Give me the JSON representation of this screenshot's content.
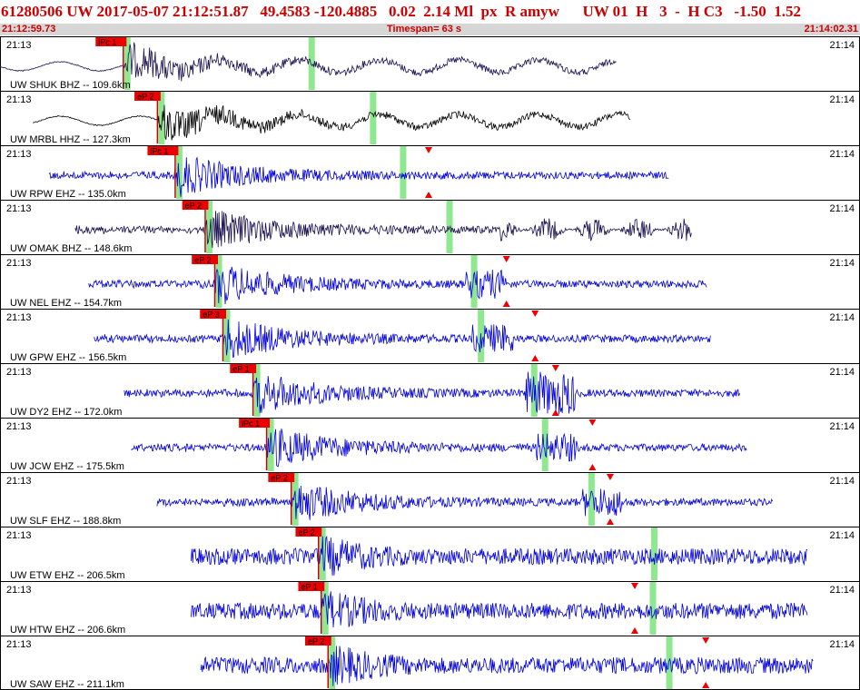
{
  "header": {
    "title": "61280506 UW 2017-05-07 21:12:51.87   49.4583 -120.4885   0.02  2.14 Ml  px  R amyw      UW 01  H   3  -  H C3   -1.50  1.52",
    "start_time": "21:12:59.73",
    "timespan": "Timespan=  63 s",
    "end_time": "21:14:02.31"
  },
  "colors": {
    "title": "#cc0000",
    "subbar_bg": "#d6d6d6",
    "pick_flag": "#ee0000",
    "pick_line": "#cc0000",
    "green_band": "#8fe88f",
    "trace_blue": "#0000dd",
    "trace_dark": "#1a1050",
    "trace_black": "#000000",
    "marker": "#ee0000"
  },
  "chart_data": {
    "type": "seismogram",
    "time_axis": {
      "start": "21:12:59.73",
      "end": "21:14:02.31",
      "span_s": 63
    },
    "panel_time_left": "21:13",
    "panel_time_right": "21:14",
    "traces": [
      {
        "label": "UW SHUK BHZ -- 109.6km",
        "pick": "iPc 1",
        "pick_s": 9.0,
        "green_s": [
          9.0,
          22.5
        ],
        "markers_s": [],
        "color": "dark",
        "start_s": 0.0,
        "end_s": 45.2,
        "pattern": "shuk"
      },
      {
        "label": "UW MRBL HHZ -- 127.3km",
        "pick": "eP 2",
        "pick_s": 11.5,
        "green_s": [
          11.5,
          27.0
        ],
        "markers_s": [],
        "color": "black",
        "start_s": 2.4,
        "end_s": 46.2,
        "pattern": "mrbl"
      },
      {
        "label": "UW RPW EHZ -- 135.0km",
        "pick": "iPc 1",
        "pick_s": 12.8,
        "green_s": [
          12.8,
          29.2
        ],
        "markers_s": [
          31.4
        ],
        "color": "blue",
        "start_s": 3.6,
        "end_s": 49.0,
        "pattern": "early"
      },
      {
        "label": "UW OMAK BHZ -- 148.6km",
        "pick": "eP 2",
        "pick_s": 15.0,
        "green_s": [
          15.0,
          32.6
        ],
        "markers_s": [],
        "color": "dark",
        "start_s": 5.5,
        "end_s": 50.7,
        "pattern": "omak"
      },
      {
        "label": "UW NEL EHZ -- 154.7km",
        "pick": "eP 2",
        "pick_s": 15.7,
        "green_s": [
          15.7,
          34.4
        ],
        "markers_s": [
          37.1
        ],
        "color": "blue",
        "start_s": 6.5,
        "end_s": 51.8,
        "pattern": "mid"
      },
      {
        "label": "UW GPW EHZ -- 156.5km",
        "pick": "eP 3",
        "pick_s": 16.3,
        "green_s": [
          16.3,
          34.9
        ],
        "markers_s": [
          39.2
        ],
        "color": "blue",
        "start_s": 6.9,
        "end_s": 52.1,
        "pattern": "mid"
      },
      {
        "label": "UW DY2 EHZ -- 172.0km",
        "pick": "eP 1",
        "pick_s": 18.5,
        "green_s": [
          18.5,
          38.8
        ],
        "markers_s": [
          40.7
        ],
        "color": "blue",
        "start_s": 9.1,
        "end_s": 54.2,
        "pattern": "late"
      },
      {
        "label": "UW JCW EHZ -- 175.5km",
        "pick": "iPc 1",
        "pick_s": 19.5,
        "green_s": [
          19.5,
          39.6
        ],
        "markers_s": [
          43.4
        ],
        "color": "blue",
        "start_s": 9.6,
        "end_s": 54.7,
        "pattern": "mid"
      },
      {
        "label": "UW SLF EHZ -- 188.8km",
        "pick": "eP 2",
        "pick_s": 21.3,
        "green_s": [
          21.3,
          43.0
        ],
        "markers_s": [
          44.7
        ],
        "color": "blue",
        "start_s": 11.5,
        "end_s": 56.6,
        "pattern": "mid"
      },
      {
        "label": "UW ETW EHZ -- 206.5km",
        "pick": "eP 2",
        "pick_s": 23.3,
        "green_s": [
          23.3,
          47.6
        ],
        "markers_s": [],
        "color": "blue",
        "start_s": 14.0,
        "end_s": 59.2,
        "pattern": "noisy"
      },
      {
        "label": "UW HTW EHZ -- 206.6km",
        "pick": "eP 1",
        "pick_s": 23.5,
        "green_s": [
          23.5,
          47.5
        ],
        "markers_s": [
          46.5
        ],
        "color": "blue",
        "start_s": 14.0,
        "end_s": 59.2,
        "pattern": "noisy"
      },
      {
        "label": "UW SAW EHZ -- 211.1km",
        "pick": "eP 2",
        "pick_s": 24.0,
        "green_s": [
          24.0,
          48.7
        ],
        "markers_s": [
          51.7
        ],
        "color": "blue",
        "start_s": 14.7,
        "end_s": 59.6,
        "pattern": "noisy"
      }
    ]
  }
}
